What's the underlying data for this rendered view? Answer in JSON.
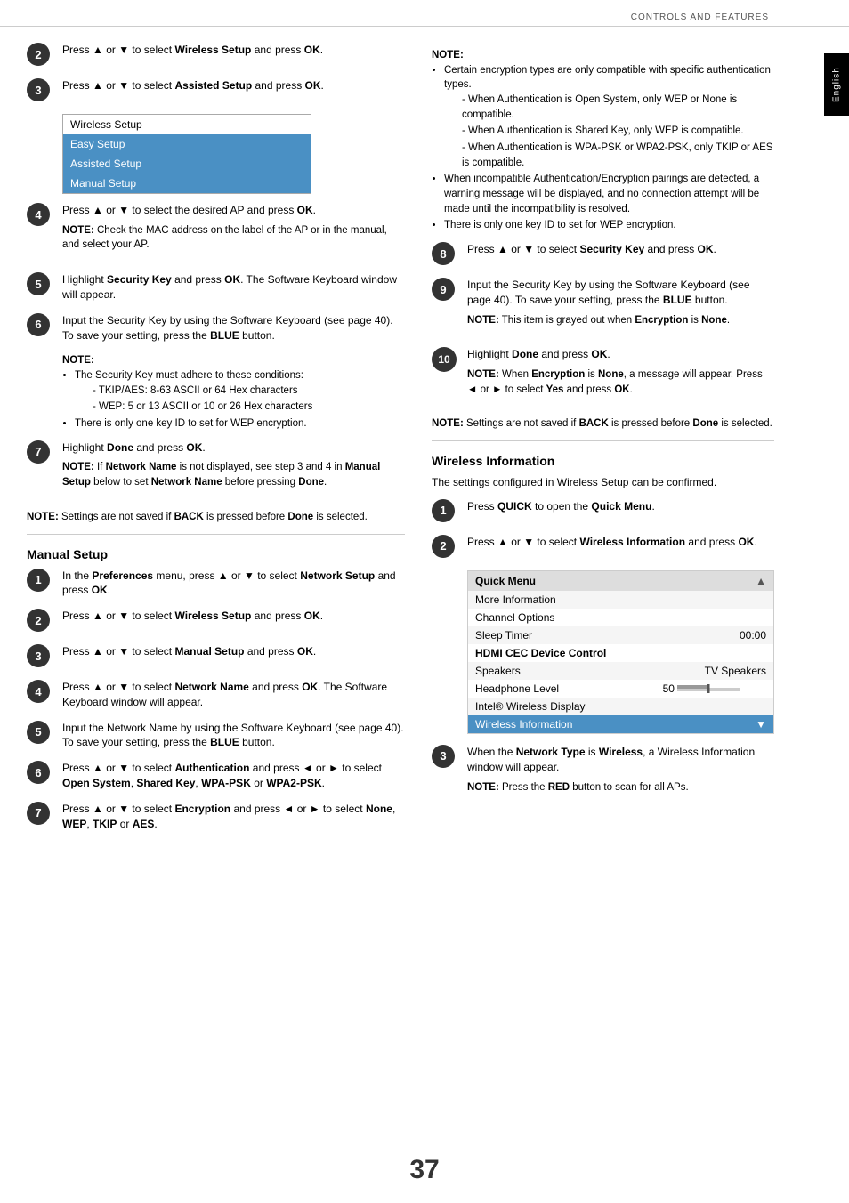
{
  "header": {
    "title": "CONTROLS AND FEATURES"
  },
  "side_tab": "English",
  "left_col": {
    "steps_top": [
      {
        "number": "2",
        "text": "Press ▲ or ▼ to select ",
        "bold": "Wireless Setup",
        "text2": " and press ",
        "bold2": "OK",
        "text3": "."
      },
      {
        "number": "3",
        "text": "Press ▲ or ▼ to select ",
        "bold": "Assisted Setup",
        "text2": " and press ",
        "bold2": "OK",
        "text3": "."
      }
    ],
    "menu_items": [
      {
        "label": "Wireless Setup",
        "selected": false
      },
      {
        "label": "Easy Setup",
        "selected": true
      },
      {
        "label": "Assisted Setup",
        "selected": true
      },
      {
        "label": "Manual Setup",
        "selected": true
      }
    ],
    "steps_middle": [
      {
        "number": "4",
        "text": "Press ▲ or ▼ to select the desired AP and press ",
        "bold": "OK",
        "text2": ".",
        "note": "NOTE: Check the MAC address on the label of the AP or in the manual, and select your AP."
      },
      {
        "number": "5",
        "text": "Highlight ",
        "bold": "Security Key",
        "text2": " and press ",
        "bold2": "OK",
        "text3": ". The Software Keyboard window will appear."
      },
      {
        "number": "6",
        "text": "Input the Security Key by using the Software Keyboard (see page 40). To save your setting, press the ",
        "bold": "BLUE",
        "text2": " button."
      }
    ],
    "note_security": {
      "title": "NOTE:",
      "bullets": [
        "The Security Key must adhere to these conditions:",
        "There is only one key ID to set for WEP encryption."
      ],
      "sub_bullets": [
        "TKIP/AES: 8-63 ASCII or 64 Hex characters",
        "WEP: 5 or 13 ASCII or 10 or 26 Hex characters"
      ]
    },
    "step7": {
      "number": "7",
      "text": "Highlight ",
      "bold": "Done",
      "text2": " and press ",
      "bold2": "OK",
      "text3": "."
    },
    "step7_note": "NOTE: If Network Name is not displayed, see step 3 and 4 in Manual Setup below to set Network Name before pressing Done.",
    "note_settings": "NOTE: Settings are not saved if BACK is pressed before Done is selected.",
    "manual_setup_title": "Manual Setup",
    "manual_steps": [
      {
        "number": "1",
        "text": "In the ",
        "bold": "Preferences",
        "text2": " menu, press ▲ or ▼ to select ",
        "bold2": "Network Setup",
        "text3": " and press ",
        "bold3": "OK",
        "text4": "."
      },
      {
        "number": "2",
        "text": "Press ▲ or ▼ to select ",
        "bold": "Wireless Setup",
        "text2": " and press ",
        "bold2": "OK",
        "text3": "."
      },
      {
        "number": "3",
        "text": "Press ▲ or ▼ to select ",
        "bold": "Manual Setup",
        "text2": " and press ",
        "bold2": "OK",
        "text3": "."
      },
      {
        "number": "4",
        "text": "Press ▲ or ▼ to select ",
        "bold": "Network Name",
        "text2": " and press ",
        "bold2": "OK",
        "text3": ". The Software Keyboard window will appear."
      },
      {
        "number": "5",
        "text": "Input the Network Name by using the Software Keyboard (see page 40). To save your setting, press the ",
        "bold": "BLUE",
        "text2": " button."
      },
      {
        "number": "6",
        "text": "Press ▲ or ▼ to select ",
        "bold": "Authentication",
        "text2": " and press ◄ or ► to select ",
        "bold2": "Open System",
        "text3": ", ",
        "bold3": "Shared Key",
        "text4": ", ",
        "bold4": "WPA-PSK",
        "text5": " or ",
        "bold5": "WPA2-PSK",
        "text6": "."
      },
      {
        "number": "7",
        "text": "Press ▲ or ▼ to select ",
        "bold": "Encryption",
        "text2": " and press ◄ or ► to select ",
        "bold2": "None",
        "text3": ", ",
        "bold3": "WEP",
        "text4": ", ",
        "bold4": "TKIP",
        "text5": " or ",
        "bold5": "AES",
        "text6": "."
      }
    ]
  },
  "right_col": {
    "note_encryption": {
      "title": "NOTE:",
      "bullets": [
        "Certain encryption types are only compatible with specific authentication types.",
        "When incompatible Authentication/Encryption pairings are detected, a warning message will be displayed, and no connection attempt will be made until the incompatibility is resolved.",
        "There is only one key ID to set for WEP encryption."
      ],
      "sub_bullets": [
        "When Authentication is Open System, only WEP or None is compatible.",
        "When Authentication is Shared Key, only WEP is compatible.",
        "When Authentication is WPA-PSK or WPA2-PSK, only TKIP or AES is compatible."
      ]
    },
    "steps": [
      {
        "number": "8",
        "text": "Press ▲ or ▼ to select ",
        "bold": "Security Key",
        "text2": " and press ",
        "bold2": "OK",
        "text3": "."
      },
      {
        "number": "9",
        "text": "Input the Security Key by using the Software Keyboard (see page 40). To save your setting, press the ",
        "bold": "BLUE",
        "text2": " button."
      }
    ],
    "step9_note": "NOTE: This item is grayed out when Encryption is None.",
    "step10": {
      "number": "10",
      "text": "Highlight ",
      "bold": "Done",
      "text2": " and press ",
      "bold2": "OK",
      "text3": "."
    },
    "step10_note": "NOTE: When Encryption is None, a message will appear. Press ◄ or ► to select Yes and press OK.",
    "note_settings": "NOTE: Settings are not saved if BACK is pressed before Done is selected.",
    "wireless_info_title": "Wireless Information",
    "wireless_info_intro": "The settings configured in Wireless Setup can be confirmed.",
    "wi_steps": [
      {
        "number": "1",
        "text": "Press ",
        "bold": "QUICK",
        "text2": " to open the ",
        "bold2": "Quick Menu",
        "text3": "."
      },
      {
        "number": "2",
        "text": "Press ▲ or ▼ to select ",
        "bold": "Wireless Information",
        "text2": " and press ",
        "bold2": "OK",
        "text3": "."
      }
    ],
    "quick_menu": {
      "header": "Quick Menu",
      "rows": [
        {
          "label": "More Information",
          "value": "",
          "selected": false
        },
        {
          "label": "Channel Options",
          "value": "",
          "selected": false
        },
        {
          "label": "Sleep Timer",
          "value": "00:00",
          "selected": false
        },
        {
          "label": "HDMI CEC Device Control",
          "value": "",
          "selected": false
        },
        {
          "label": "Speakers",
          "value": "TV Speakers",
          "selected": false
        },
        {
          "label": "Headphone Level",
          "value": "50",
          "selected": false,
          "slider": true
        },
        {
          "label": "Intel® Wireless Display",
          "value": "",
          "selected": false
        },
        {
          "label": "Wireless Information",
          "value": "",
          "selected": true
        }
      ]
    },
    "wi_step3": {
      "number": "3",
      "text": "When the ",
      "bold": "Network Type",
      "text2": " is ",
      "bold2": "Wireless",
      "text3": ", a Wireless Information window will appear."
    },
    "wi_step3_note": "NOTE: Press the RED button to scan for all APs."
  },
  "page_number": "37"
}
